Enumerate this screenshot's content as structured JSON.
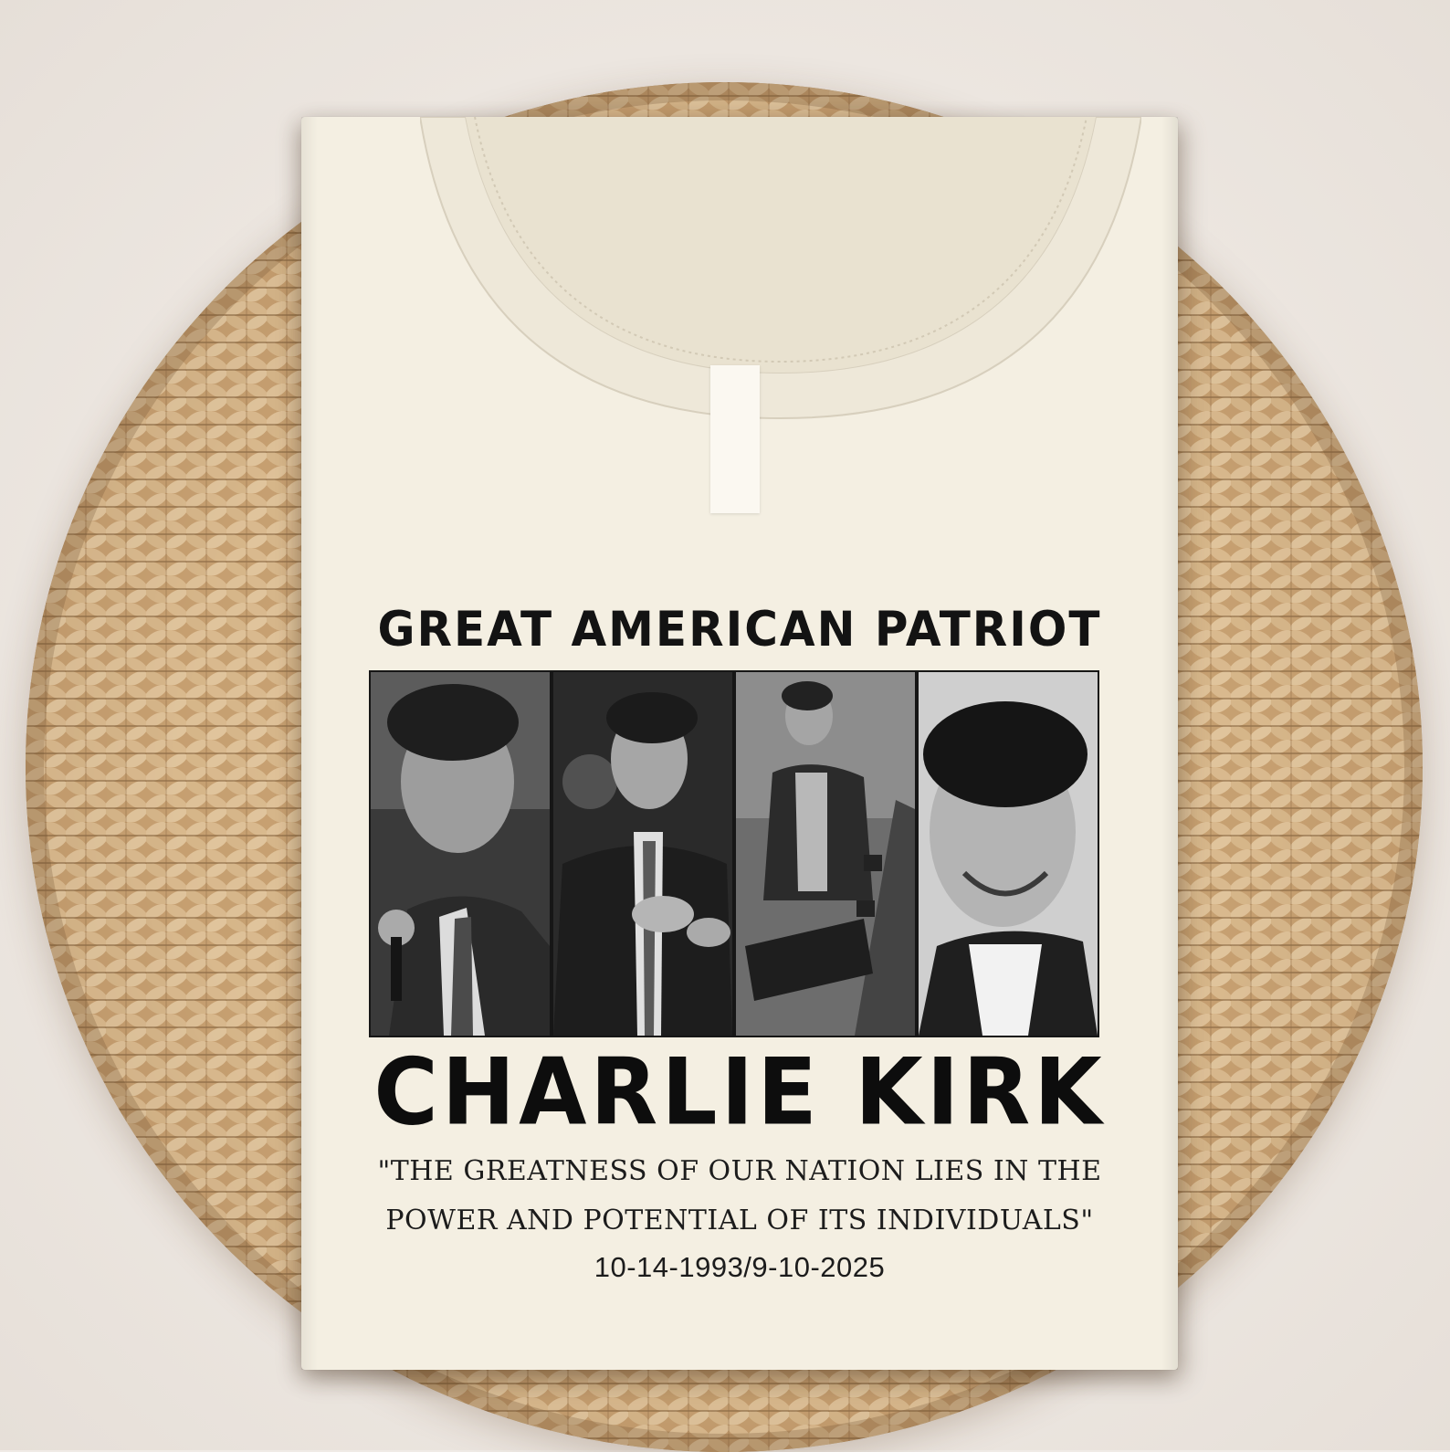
{
  "scene": {
    "colors": {
      "background": "#f0ebe6",
      "wicker": "#c9a57a",
      "shirt": "#f4efe2",
      "ink": "#131313"
    },
    "props": [
      "woven-pouf",
      "folded-tshirt"
    ]
  },
  "print": {
    "title": "GREAT AMERICAN PATRIOT",
    "photos": [
      {
        "name": "photo-speaking-microphone"
      },
      {
        "name": "photo-clapping-suit"
      },
      {
        "name": "photo-seated-bench"
      },
      {
        "name": "photo-smiling-portrait"
      }
    ],
    "name": "CHARLIE KIRK",
    "quote_line_1": "\"THE GREATNESS OF OUR NATION LIES IN THE",
    "quote_line_2": "POWER AND POTENTIAL OF ITS INDIVIDUALS\"",
    "dates": "10-14-1993/9-10-2025"
  }
}
